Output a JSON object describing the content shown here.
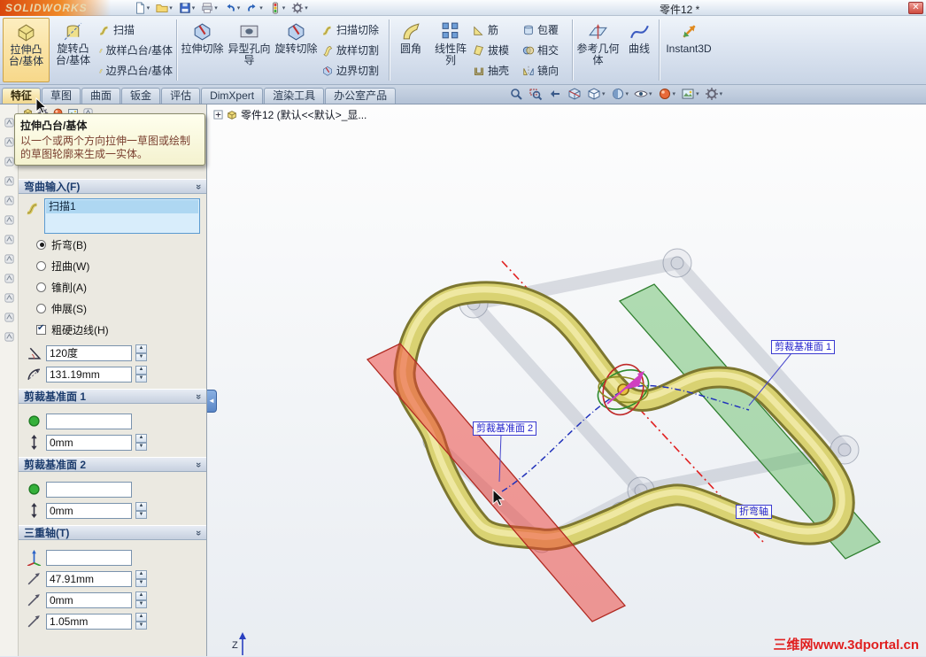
{
  "titlebar": {
    "logo": "SOLIDWORKS",
    "title": "零件12 *",
    "close_label": "✕"
  },
  "ribbon": {
    "buttons": [
      {
        "label": "拉伸凸台/基体",
        "size": "large"
      },
      {
        "label": "旋转凸台/基体",
        "size": "large"
      },
      {
        "label": "扫描",
        "size": "small"
      },
      {
        "label": "放样凸台/基体",
        "size": "small"
      },
      {
        "label": "边界凸台/基体",
        "size": "small"
      },
      {
        "label": "拉伸切除",
        "size": "large"
      },
      {
        "label": "异型孔向导",
        "size": "large"
      },
      {
        "label": "旋转切除",
        "size": "large"
      },
      {
        "label": "扫描切除",
        "size": "small"
      },
      {
        "label": "放样切割",
        "size": "small"
      },
      {
        "label": "边界切割",
        "size": "small"
      },
      {
        "label": "圆角",
        "size": "large"
      },
      {
        "label": "线性阵列",
        "size": "large"
      },
      {
        "label": "筋",
        "size": "small"
      },
      {
        "label": "拔模",
        "size": "small"
      },
      {
        "label": "抽壳",
        "size": "small"
      },
      {
        "label": "包覆",
        "size": "small"
      },
      {
        "label": "相交",
        "size": "small"
      },
      {
        "label": "镜向",
        "size": "small"
      },
      {
        "label": "参考几何体",
        "size": "large"
      },
      {
        "label": "曲线",
        "size": "large"
      },
      {
        "label": "Instant3D",
        "size": "large"
      }
    ]
  },
  "tabs": {
    "items": [
      {
        "label": "特征",
        "active": true
      },
      {
        "label": "草图",
        "active": false
      },
      {
        "label": "曲面",
        "active": false
      },
      {
        "label": "钣金",
        "active": false
      },
      {
        "label": "评估",
        "active": false
      },
      {
        "label": "DimXpert",
        "active": false
      },
      {
        "label": "渲染工具",
        "active": false
      },
      {
        "label": "办公室产品",
        "active": false
      }
    ]
  },
  "tooltip": {
    "title": "拉伸凸台/基体",
    "body": "以一个或两个方向拉伸一草图或绘制的草图轮廓来生成一实体。"
  },
  "pm": {
    "header": "弯曲输入(F)",
    "selection_item": "扫描1",
    "radio_bend": "折弯(B)",
    "radio_bend_checked": true,
    "radio_twist": "扭曲(W)",
    "radio_taper": "锥削(A)",
    "radio_stretch": "伸展(S)",
    "hard_edges": "粗硬边线(H)",
    "hard_edges_checked": true,
    "angle": "120度",
    "radius": "131.19mm",
    "trim1_header": "剪裁基准面 1",
    "trim1_offset": "0mm",
    "trim2_header": "剪裁基准面 2",
    "trim2_offset": "0mm",
    "triad_header": "三重轴(T)",
    "triad_x": "47.91mm",
    "triad_y": "0mm",
    "triad_z": "1.05mm"
  },
  "viewport": {
    "tree_item": "零件12 (默认<<默认>_显...",
    "label_trim1": "剪裁基准面 1",
    "label_trim2": "剪裁基准面 2",
    "label_bend_axis": "折弯轴",
    "watermark": "三维网www.3dportal.cn",
    "axis_z": "Z"
  },
  "colors": {
    "tube": "#d9d272",
    "plane_red": "#ee3b33",
    "plane_green": "#58b858",
    "accent_blue": "#2b5fb4"
  }
}
